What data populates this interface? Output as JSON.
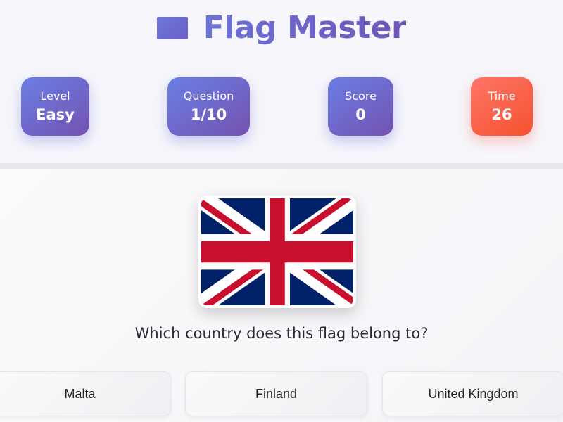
{
  "app": {
    "title": "Flag Master",
    "logo_icon": "flag-icon",
    "accent_color": "#6a6fd5",
    "time_color": "#f65e3c"
  },
  "stats": {
    "level": {
      "label": "Level",
      "value": "Easy"
    },
    "question": {
      "label": "Question",
      "value": "1/10"
    },
    "score": {
      "label": "Score",
      "value": "0"
    },
    "time": {
      "label": "Time",
      "value": "26"
    }
  },
  "quiz": {
    "flag_icon": "united-kingdom-flag",
    "question_text": "Which country does this flag belong to?",
    "answers": [
      {
        "label": "Malta"
      },
      {
        "label": "Finland"
      },
      {
        "label": "United Kingdom"
      }
    ]
  }
}
